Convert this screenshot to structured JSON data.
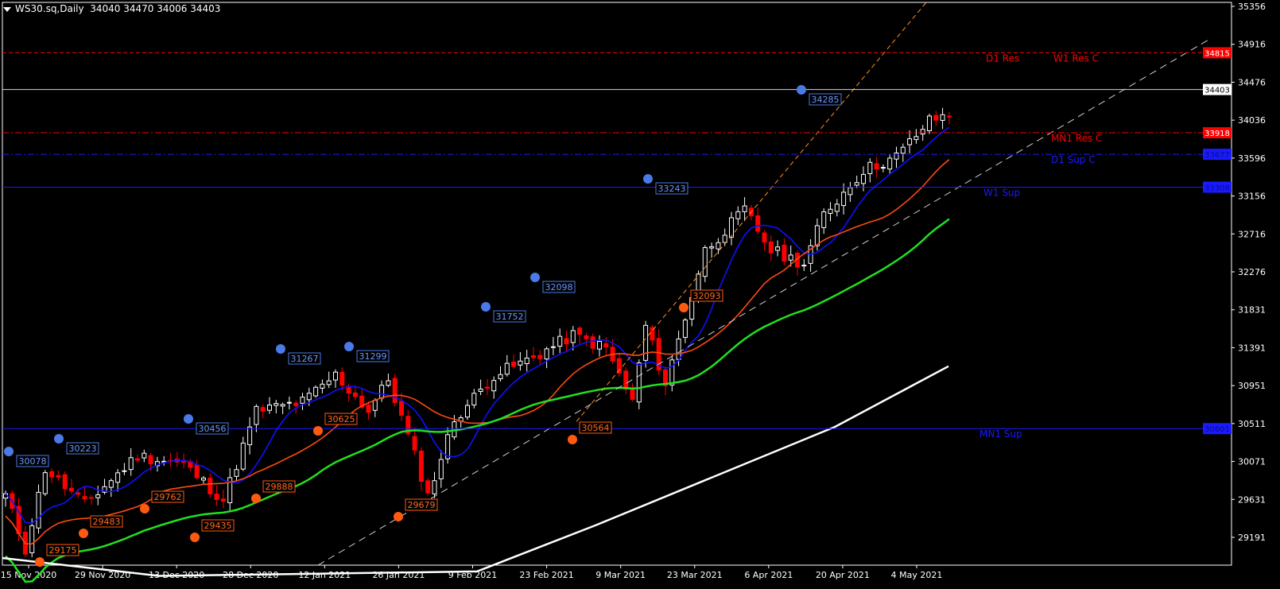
{
  "header": {
    "symbol": "WS30.sq,Daily",
    "ohlc": "34040 34470 34006 34403"
  },
  "colors": {
    "background": "#000000",
    "axis": "#ffffff",
    "bull": "#ffffff",
    "bear": "#ff0000",
    "ma_blue": "#1010ff",
    "ma_orange": "#ff4a10",
    "ma_green": "#20e020",
    "ma_white": "#ffffff",
    "res": "#ff0000",
    "sup": "#1a1aff"
  },
  "chart_data": {
    "type": "candlestick",
    "title": "WS30.sq,Daily",
    "y_ticks": [
      "35356",
      "34916",
      "34476",
      "34036",
      "33596",
      "33156",
      "32716",
      "32276",
      "31831",
      "31391",
      "30951",
      "30511",
      "30071",
      "29631",
      "29191"
    ],
    "x_ticks": [
      "15 Nov 2020",
      "29 Nov 2020",
      "13 Dec 2020",
      "28 Dec 2020",
      "12 Jan 2021",
      "26 Jan 2021",
      "9 Feb 2021",
      "23 Feb 2021",
      "9 Mar 2021",
      "23 Mar 2021",
      "6 Apr 2021",
      "20 Apr 2021",
      "4 May 2021"
    ],
    "ylim": [
      29070,
      35380
    ],
    "current_price": "34403",
    "levels": [
      {
        "price": 34815,
        "label": "34815",
        "names": [
          "D1 Res",
          "W1 Res C"
        ],
        "color": "#ff0000",
        "style": "dash"
      },
      {
        "price": 33918,
        "label": "33918",
        "names": [
          "MN1 Res C"
        ],
        "color": "#ff0000",
        "style": "dashdot"
      },
      {
        "price": 33677,
        "label": "33677",
        "names": [
          "D1 Sup C"
        ],
        "color": "#1a1aff",
        "style": "dashdot"
      },
      {
        "price": 33308,
        "label": "33308",
        "names": [
          "W1 Sup"
        ],
        "color": "#1a1aff",
        "style": "solid"
      },
      {
        "price": 30601,
        "label": "30601",
        "names": [
          "MN1 Sup"
        ],
        "color": "#1a1aff",
        "style": "solid"
      }
    ],
    "swing_highs": [
      "30078",
      "30223",
      "30456",
      "31267",
      "31299",
      "31752",
      "32098",
      "33243",
      "34285"
    ],
    "swing_lows": [
      "29175",
      "29483",
      "29762",
      "29435",
      "29888",
      "30625",
      "29679",
      "30564",
      "32093"
    ]
  }
}
